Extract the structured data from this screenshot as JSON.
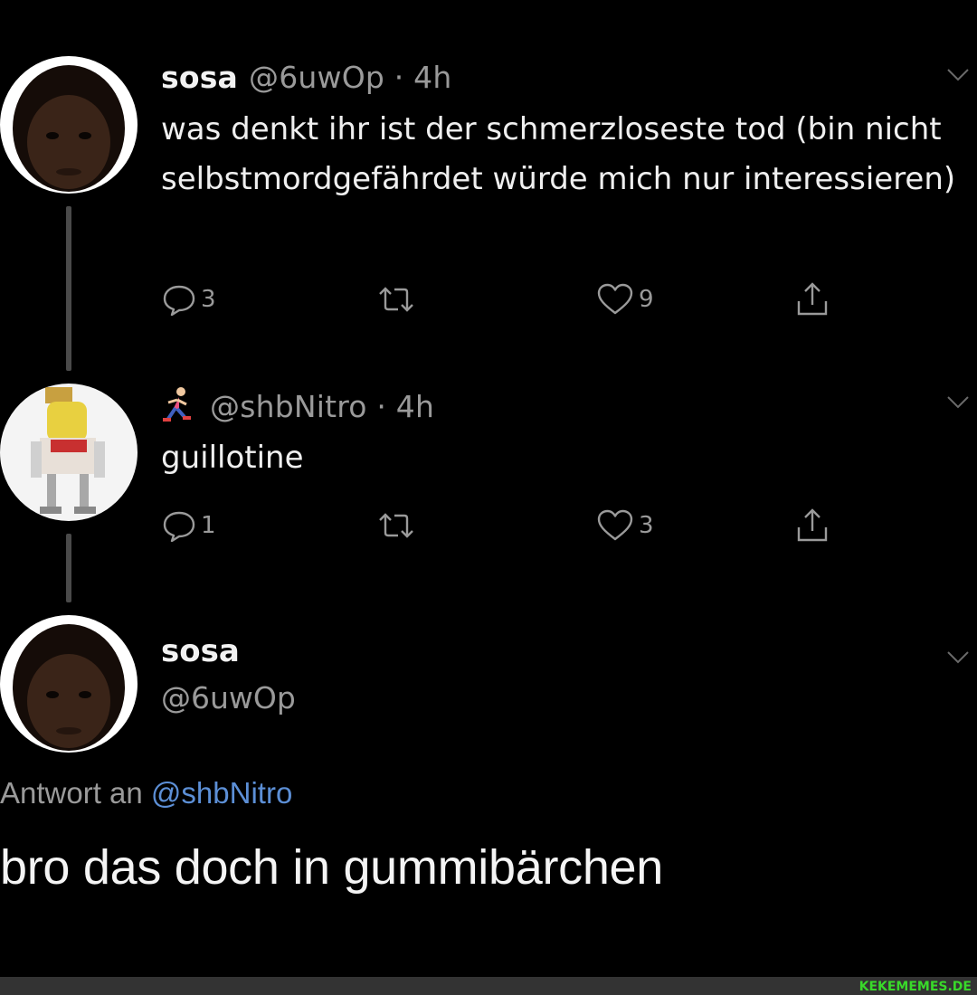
{
  "thread": {
    "tweet1": {
      "name": "sosa",
      "handle_time": "@6uwOp · 4h",
      "text": "was denkt ihr ist der schmerzloseste tod (bin nicht selbstmordgefährdet würde mich nur interessieren)",
      "actions": {
        "reply_count": "3",
        "like_count": "9"
      }
    },
    "tweet2": {
      "emoji_icon": "runner-icon",
      "handle_time": "@shbNitro · 4h",
      "text": "guillotine",
      "actions": {
        "reply_count": "1",
        "like_count": "3"
      }
    },
    "tweet3": {
      "name": "sosa",
      "handle": "@6uwOp",
      "reply_prefix": "Antwort an",
      "reply_mention": "@shbNitro",
      "text": "bro das doch in gummibärchen"
    }
  },
  "icons": {
    "reply": "speech-bubble-icon",
    "retweet": "retweet-icon",
    "like": "heart-icon",
    "share": "share-icon",
    "menu": "chevron-down-icon"
  },
  "colors": {
    "background": "#000000",
    "mention": "#5c8fd6",
    "muted": "#9a9a9a",
    "watermark": "#39d92a"
  },
  "watermark": "KEKEMEMES.DE"
}
